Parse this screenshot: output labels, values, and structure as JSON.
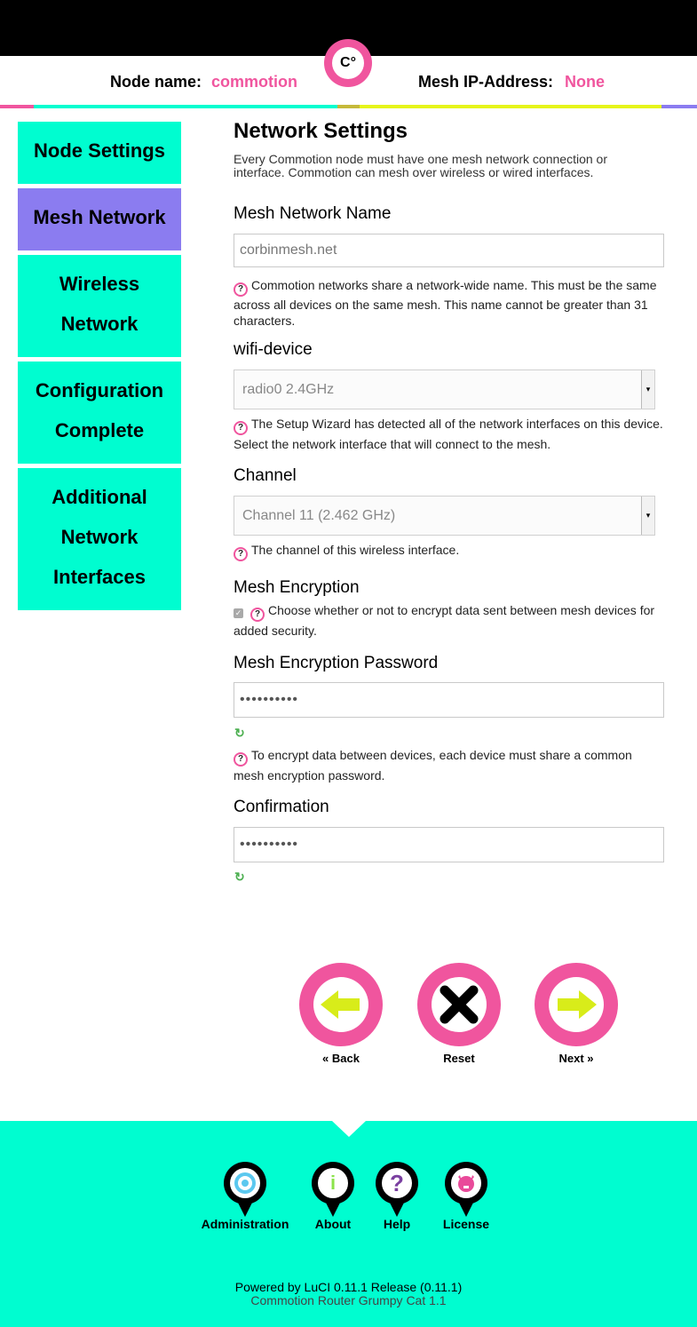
{
  "header": {
    "node_name_label": "Node name:",
    "node_name_value": "commotion",
    "mesh_ip_label": "Mesh IP-Address:",
    "mesh_ip_value": "None",
    "logo_text": "C°"
  },
  "colors": {
    "accent_pink": "#f0559e",
    "teal": "#00fdd0",
    "purple": "#8b7cf0",
    "lime": "#e6f51a"
  },
  "sidebar": {
    "items": [
      {
        "lines": [
          "Node Settings"
        ],
        "active": false
      },
      {
        "lines": [
          "Mesh Network"
        ],
        "active": true
      },
      {
        "lines": [
          "Wireless",
          "Network"
        ],
        "active": false
      },
      {
        "lines": [
          "Configuration",
          "Complete"
        ],
        "active": false
      },
      {
        "lines": [
          "Additional",
          "Network",
          "Interfaces"
        ],
        "active": false
      }
    ]
  },
  "main": {
    "title": "Network Settings",
    "intro": "Every Commotion node must have one mesh network connection or interface. Commotion can mesh over wireless or wired interfaces.",
    "mesh_name": {
      "label": "Mesh Network Name",
      "value": "corbinmesh.net",
      "help": "Commotion networks share a network-wide name. This must be the same across all devices on the same mesh. This name cannot be greater than 31 characters."
    },
    "wifi_device": {
      "label": "wifi-device",
      "selected": "radio0 2.4GHz",
      "help": "The Setup Wizard has detected all of the network interfaces on this device. Select the network interface that will connect to the mesh."
    },
    "channel": {
      "label": "Channel",
      "selected": "Channel 11 (2.462 GHz)",
      "help": "The channel of this wireless interface."
    },
    "encryption": {
      "label": "Mesh Encryption",
      "checked": true,
      "help": "Choose whether or not to encrypt data sent between mesh devices for added security."
    },
    "password": {
      "label": "Mesh Encryption Password",
      "value": "••••••••••",
      "help": "To encrypt data between devices, each device must share a common mesh encryption password."
    },
    "confirmation": {
      "label": "Confirmation",
      "value": "••••••••••"
    }
  },
  "actions": {
    "back_label": "« Back",
    "reset_label": "Reset",
    "next_label": "Next »"
  },
  "footer": {
    "links": [
      {
        "label": "Administration",
        "icon": "administration-icon"
      },
      {
        "label": "About",
        "icon": "info-icon"
      },
      {
        "label": "Help",
        "icon": "help-icon"
      },
      {
        "label": "License",
        "icon": "license-icon"
      }
    ],
    "powered_by": "Powered by LuCI 0.11.1 Release (0.11.1)",
    "version": "Commotion Router Grumpy Cat 1.1"
  }
}
